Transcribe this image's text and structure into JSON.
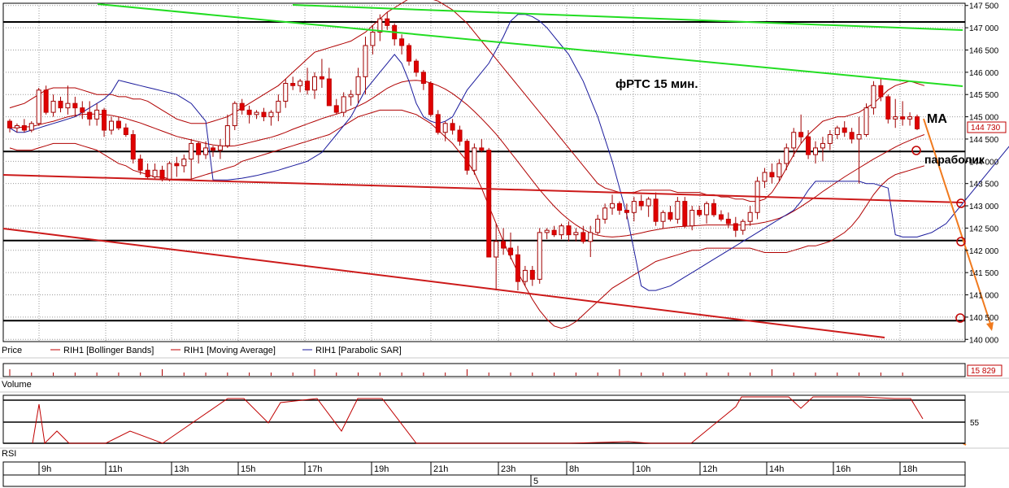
{
  "chart_data": {
    "type": "candlestick",
    "y_ticks": [
      "147 500",
      "147 000",
      "146 500",
      "146 000",
      "145 500",
      "145 000",
      "144 500",
      "144 000",
      "143 500",
      "143 000",
      "142 500",
      "142 000",
      "141 500",
      "141 000",
      "140 500",
      "140 000"
    ],
    "ylim": [
      139950,
      147550
    ],
    "grid": true,
    "x_ticks": [
      "9h",
      "11h",
      "13h",
      "15h",
      "17h",
      "19h",
      "21h",
      "23h",
      "8h",
      "10h",
      "12h",
      "14h",
      "16h",
      "18h"
    ],
    "x_day_marker": "5",
    "last_price": "144 730",
    "volume_last": "15 829",
    "rsi_level": "55",
    "legend": [
      {
        "name": "Price",
        "color": "#000000"
      },
      {
        "name": "RIH1 [Bollinger Bands]",
        "color": "#c00000"
      },
      {
        "name": "RIH1 [Moving Average]",
        "color": "#c00000"
      },
      {
        "name": "RIH1 [Parabolic SAR]",
        "color": "#1a1a9c"
      }
    ],
    "panel_labels": {
      "volume": "Volume",
      "rsi": "RSI"
    },
    "annotations": {
      "title": "фРТС  15 мин.",
      "ma": "MA",
      "sar": "параболик"
    },
    "horizontal_levels": [
      147130,
      144220,
      142220,
      140420
    ],
    "ohlc": [
      [
        144900,
        144950,
        144650,
        144750
      ],
      [
        144750,
        144850,
        144650,
        144800
      ],
      [
        144800,
        144950,
        144650,
        144700
      ],
      [
        144700,
        144900,
        144650,
        144850
      ],
      [
        144850,
        145650,
        144800,
        145600
      ],
      [
        145600,
        145700,
        145050,
        145100
      ],
      [
        145100,
        145500,
        145000,
        145350
      ],
      [
        145350,
        145450,
        145100,
        145200
      ],
      [
        145200,
        145700,
        145050,
        145300
      ],
      [
        145300,
        145450,
        145000,
        145200
      ],
      [
        145200,
        145350,
        144950,
        145100
      ],
      [
        145100,
        145350,
        144800,
        144950
      ],
      [
        144950,
        145300,
        144800,
        145150
      ],
      [
        145150,
        145200,
        144550,
        144700
      ],
      [
        144700,
        145000,
        144600,
        144900
      ],
      [
        144900,
        145000,
        144700,
        144750
      ],
      [
        144750,
        144850,
        144550,
        144600
      ],
      [
        144600,
        144700,
        143950,
        144050
      ],
      [
        144050,
        144150,
        143700,
        143800
      ],
      [
        143800,
        143950,
        143600,
        143650
      ],
      [
        143650,
        143950,
        143600,
        143800
      ],
      [
        143800,
        143900,
        143550,
        143600
      ],
      [
        143600,
        144000,
        143550,
        143950
      ],
      [
        143950,
        144100,
        143650,
        143900
      ],
      [
        143900,
        144150,
        143750,
        144050
      ],
      [
        144050,
        144500,
        143600,
        144400
      ],
      [
        144400,
        144450,
        143950,
        144150
      ],
      [
        144150,
        144450,
        144050,
        144300
      ],
      [
        144300,
        144350,
        144100,
        144250
      ],
      [
        144250,
        144500,
        144050,
        144350
      ],
      [
        144350,
        145050,
        144300,
        144800
      ],
      [
        144800,
        145350,
        144700,
        145300
      ],
      [
        145300,
        145400,
        145050,
        145150
      ],
      [
        145150,
        145250,
        144850,
        145050
      ],
      [
        145050,
        145150,
        144950,
        145100
      ],
      [
        145100,
        145200,
        144900,
        145000
      ],
      [
        145000,
        145150,
        144800,
        145100
      ],
      [
        145100,
        145500,
        144900,
        145350
      ],
      [
        145350,
        145850,
        145200,
        145750
      ],
      [
        145750,
        145900,
        145600,
        145700
      ],
      [
        145700,
        145850,
        145550,
        145800
      ],
      [
        145800,
        146100,
        145500,
        145600
      ],
      [
        145600,
        146000,
        145400,
        145900
      ],
      [
        145900,
        146300,
        145650,
        145850
      ],
      [
        145850,
        146100,
        145300,
        145250
      ],
      [
        145250,
        145400,
        145050,
        145100
      ],
      [
        145100,
        145550,
        145000,
        145450
      ],
      [
        145450,
        145600,
        145250,
        145500
      ],
      [
        145500,
        146100,
        145300,
        145900
      ],
      [
        145900,
        146800,
        145500,
        146600
      ],
      [
        146600,
        147050,
        146400,
        146900
      ],
      [
        146900,
        147300,
        146700,
        147200
      ],
      [
        147200,
        147350,
        146950,
        147050
      ],
      [
        147050,
        147100,
        146600,
        146750
      ],
      [
        146750,
        146850,
        146400,
        146600
      ],
      [
        146600,
        146650,
        146150,
        146250
      ],
      [
        146250,
        146300,
        145900,
        146000
      ],
      [
        146000,
        146050,
        145600,
        145750
      ],
      [
        145750,
        145800,
        145000,
        145050
      ],
      [
        145050,
        145150,
        144600,
        144650
      ],
      [
        144650,
        144900,
        144450,
        144850
      ],
      [
        144850,
        144950,
        144600,
        144700
      ],
      [
        144700,
        144800,
        144350,
        144450
      ],
      [
        144450,
        144500,
        143700,
        143800
      ],
      [
        143800,
        144400,
        143700,
        144300
      ],
      [
        144300,
        144500,
        144200,
        144250
      ],
      [
        144250,
        144300,
        142400,
        141850
      ],
      [
        141850,
        142600,
        141100,
        142200
      ],
      [
        142200,
        142500,
        141900,
        142050
      ],
      [
        142050,
        142400,
        141800,
        141900
      ],
      [
        141900,
        142100,
        141100,
        141300
      ],
      [
        141300,
        141650,
        141200,
        141550
      ],
      [
        141550,
        141650,
        141200,
        141350
      ],
      [
        141350,
        142500,
        141250,
        142400
      ],
      [
        142400,
        142500,
        142250,
        142450
      ],
      [
        142450,
        142550,
        142300,
        142350
      ],
      [
        142350,
        142600,
        142250,
        142550
      ],
      [
        142550,
        142650,
        142200,
        142350
      ],
      [
        142350,
        142500,
        142200,
        142400
      ],
      [
        142400,
        142550,
        142150,
        142200
      ],
      [
        142200,
        142550,
        141850,
        142400
      ],
      [
        142400,
        142800,
        142350,
        142700
      ],
      [
        142700,
        143050,
        142600,
        142950
      ],
      [
        142950,
        143250,
        142800,
        143050
      ],
      [
        143050,
        143100,
        142800,
        142900
      ],
      [
        142900,
        143050,
        142700,
        142850
      ],
      [
        142850,
        143200,
        142650,
        143100
      ],
      [
        143100,
        143250,
        142900,
        143000
      ],
      [
        143000,
        143200,
        142750,
        143150
      ],
      [
        143150,
        143300,
        142550,
        142650
      ],
      [
        142650,
        142900,
        142500,
        142850
      ],
      [
        142850,
        143000,
        142650,
        142700
      ],
      [
        142700,
        143200,
        142600,
        143100
      ],
      [
        143100,
        143200,
        142500,
        142550
      ],
      [
        142550,
        143000,
        142450,
        142900
      ],
      [
        142900,
        143000,
        142750,
        142800
      ],
      [
        142800,
        143100,
        142600,
        143050
      ],
      [
        143050,
        143150,
        142750,
        142800
      ],
      [
        142800,
        142900,
        142650,
        142700
      ],
      [
        142700,
        142850,
        142500,
        142600
      ],
      [
        142600,
        142750,
        142300,
        142450
      ],
      [
        142450,
        142700,
        142350,
        142650
      ],
      [
        142650,
        143000,
        142550,
        142850
      ],
      [
        142850,
        143650,
        142700,
        143550
      ],
      [
        143550,
        143850,
        143400,
        143750
      ],
      [
        143750,
        143950,
        143500,
        143650
      ],
      [
        143650,
        144050,
        143550,
        143950
      ],
      [
        143950,
        144400,
        143800,
        144300
      ],
      [
        144300,
        144750,
        144100,
        144650
      ],
      [
        144650,
        145050,
        144400,
        144550
      ],
      [
        144550,
        144700,
        144050,
        144150
      ],
      [
        144150,
        144450,
        143950,
        144300
      ],
      [
        144300,
        144550,
        144000,
        144400
      ],
      [
        144400,
        144700,
        144250,
        144600
      ],
      [
        144600,
        144800,
        144500,
        144750
      ],
      [
        144750,
        144900,
        144550,
        144650
      ],
      [
        144650,
        144750,
        144400,
        144500
      ],
      [
        144500,
        145000,
        143500,
        144600
      ],
      [
        144600,
        145300,
        144550,
        145200
      ],
      [
        145200,
        145800,
        145050,
        145700
      ],
      [
        145700,
        145850,
        145350,
        145450
      ],
      [
        145450,
        145500,
        144850,
        144950
      ],
      [
        144950,
        145400,
        144750,
        145000
      ],
      [
        145000,
        145350,
        144800,
        144950
      ],
      [
        144950,
        145100,
        144800,
        145000
      ],
      [
        145000,
        145050,
        144700,
        144730
      ]
    ],
    "ma_line": [
      144750,
      144760,
      144770,
      144780,
      144820,
      144860,
      144900,
      144950,
      145000,
      145030,
      145050,
      145060,
      145060,
      145050,
      145030,
      145000,
      144960,
      144910,
      144860,
      144800,
      144740,
      144680,
      144620,
      144560,
      144520,
      144480,
      144440,
      144400,
      144370,
      144350,
      144340,
      144350,
      144380,
      144420,
      144460,
      144500,
      144540,
      144590,
      144650,
      144720,
      144780,
      144840,
      144900,
      144960,
      145010,
      145060,
      145110,
      145170,
      145240,
      145320,
      145420,
      145530,
      145640,
      145720,
      145780,
      145810,
      145820,
      145800,
      145760,
      145700,
      145620,
      145520,
      145400,
      145270,
      145120,
      144960,
      144790,
      144610,
      144410,
      144200,
      143990,
      143780,
      143570,
      143360,
      143170,
      142990,
      142830,
      142690,
      142570,
      142470,
      142390,
      142340,
      142310,
      142300,
      142310,
      142330,
      142360,
      142390,
      142430,
      142460,
      142490,
      142510,
      142530,
      142540,
      142550,
      142560,
      142570,
      142570,
      142570,
      142570,
      142570,
      142570,
      142580,
      142600,
      142630,
      142670,
      142720,
      142790,
      142880,
      142980,
      143090,
      143200,
      143320,
      143430,
      143540,
      143650,
      143750,
      143850,
      143950,
      144050,
      144140,
      144230,
      144320,
      144400,
      144470,
      144540,
      144600
    ],
    "bb_upper": [
      145200,
      145250,
      145300,
      145400,
      145500,
      145600,
      145650,
      145650,
      145650,
      145650,
      145600,
      145550,
      145500,
      145500,
      145500,
      145450,
      145450,
      145400,
      145400,
      145350,
      145250,
      145150,
      145050,
      144950,
      144900,
      144850,
      144850,
      144850,
      144900,
      144950,
      145000,
      145100,
      145200,
      145300,
      145400,
      145500,
      145600,
      145700,
      145850,
      146000,
      146150,
      146300,
      146450,
      146500,
      146550,
      146600,
      146650,
      146700,
      146800,
      146900,
      147050,
      147200,
      147350,
      147450,
      147550,
      147650,
      147700,
      147700,
      147650,
      147600,
      147500,
      147400,
      147250,
      147100,
      146900,
      146700,
      146500,
      146300,
      146100,
      145900,
      145700,
      145500,
      145300,
      145100,
      144900,
      144700,
      144500,
      144300,
      144100,
      143900,
      143700,
      143500,
      143400,
      143350,
      143300,
      143300,
      143300,
      143350,
      143350,
      143350,
      143350,
      143350,
      143300,
      143300,
      143300,
      143300,
      143250,
      143250,
      143200,
      143200,
      143150,
      143150,
      143100,
      143100,
      143150,
      143300,
      143550,
      143850,
      144150,
      144400,
      144600,
      144750,
      144900,
      144950,
      145000,
      145000,
      145050,
      145100,
      145200,
      145300,
      145450,
      145600,
      145700,
      145750,
      145800,
      145750,
      145700
    ],
    "bb_lower": [
      144300,
      144250,
      144250,
      144250,
      144300,
      144350,
      144400,
      144400,
      144400,
      144400,
      144350,
      144300,
      144250,
      144150,
      144050,
      143950,
      143900,
      143800,
      143750,
      143700,
      143650,
      143650,
      143600,
      143600,
      143600,
      143600,
      143650,
      143700,
      143750,
      143800,
      143850,
      143900,
      144000,
      144050,
      144100,
      144150,
      144200,
      144250,
      144300,
      144350,
      144400,
      144450,
      144500,
      144550,
      144600,
      144700,
      144800,
      144900,
      145000,
      145050,
      145100,
      145150,
      145150,
      145150,
      145150,
      145100,
      145050,
      144950,
      144850,
      144700,
      144550,
      144400,
      144200,
      144000,
      143750,
      143400,
      143000,
      142600,
      142200,
      141850,
      141500,
      141200,
      140900,
      140650,
      140450,
      140300,
      140250,
      140300,
      140400,
      140550,
      140700,
      140850,
      141000,
      141150,
      141250,
      141350,
      141450,
      141550,
      141650,
      141750,
      141800,
      141850,
      141900,
      141950,
      142000,
      142000,
      142050,
      142050,
      142050,
      142050,
      142050,
      142050,
      142050,
      142000,
      141950,
      141950,
      141950,
      141950,
      142000,
      142050,
      142100,
      142100,
      142150,
      142200,
      142300,
      142400,
      142550,
      142750,
      143000,
      143250,
      143450,
      143600,
      143700,
      143750,
      143800,
      143850,
      143900
    ],
    "sar": [
      144750,
      144650,
      144650,
      144700,
      144750,
      144800,
      144850,
      144900,
      144950,
      145000,
      145100,
      145200,
      145300,
      145400,
      145550,
      145820,
      145780,
      145740,
      145700,
      145660,
      145620,
      145580,
      145540,
      145500,
      145400,
      145300,
      145100,
      144900,
      143580,
      143580,
      143580,
      143600,
      143620,
      143650,
      143680,
      143720,
      143760,
      143800,
      143850,
      143900,
      143950,
      144000,
      144100,
      144200,
      144400,
      144600,
      144800,
      145000,
      145300,
      145600,
      145800,
      146000,
      146200,
      146400,
      146200,
      145800,
      145300,
      145000,
      144900,
      144850,
      144900,
      145000,
      145300,
      145600,
      145800,
      146000,
      146200,
      146500,
      146800,
      147150,
      147300,
      147300,
      147250,
      147150,
      147000,
      146800,
      146600,
      146400,
      146100,
      145800,
      145400,
      145000,
      144500,
      144000,
      143400,
      142800,
      142000,
      141200,
      141100,
      141100,
      141150,
      141200,
      141300,
      141400,
      141500,
      141600,
      141700,
      141800,
      141900,
      142000,
      142100,
      142200,
      142300,
      142400,
      142500,
      142600,
      142700,
      142800,
      142900,
      143100,
      143350,
      143550,
      143550,
      143550,
      143550,
      143550,
      143550,
      143550,
      143500,
      143500,
      143450,
      143400,
      142350,
      142300,
      142300,
      142300,
      142350,
      142400,
      142500,
      142600,
      142800,
      143000,
      143200,
      143400,
      143600,
      143800,
      144000,
      144200,
      144400,
      145000,
      145000,
      143700,
      143750,
      143850,
      143950,
      144050,
      144100
    ]
  }
}
